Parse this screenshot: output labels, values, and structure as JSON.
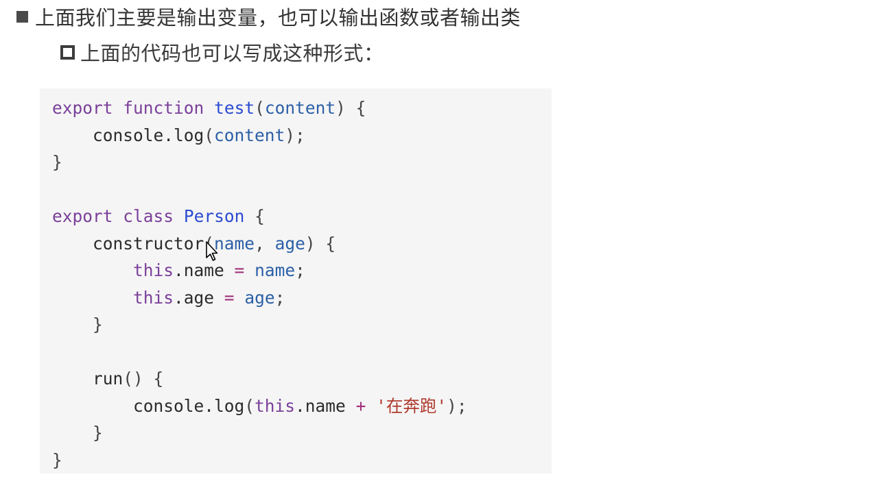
{
  "bullets": [
    {
      "text": "上面我们主要是输出变量，也可以输出函数或者输出类"
    },
    {
      "text": "上面的代码也可以写成这种形式："
    }
  ],
  "code": {
    "lines": [
      [
        {
          "t": "export",
          "c": "kw"
        },
        {
          "t": " ",
          "c": "plain"
        },
        {
          "t": "function",
          "c": "kw"
        },
        {
          "t": " ",
          "c": "plain"
        },
        {
          "t": "test",
          "c": "fn"
        },
        {
          "t": "(",
          "c": "punc"
        },
        {
          "t": "content",
          "c": "param"
        },
        {
          "t": ") {",
          "c": "punc"
        }
      ],
      [
        {
          "t": "    console.log",
          "c": "plain"
        },
        {
          "t": "(",
          "c": "punc"
        },
        {
          "t": "content",
          "c": "param"
        },
        {
          "t": ");",
          "c": "punc"
        }
      ],
      [
        {
          "t": "}",
          "c": "punc"
        }
      ],
      [],
      [
        {
          "t": "export",
          "c": "kw"
        },
        {
          "t": " ",
          "c": "plain"
        },
        {
          "t": "class",
          "c": "kw"
        },
        {
          "t": " ",
          "c": "plain"
        },
        {
          "t": "Person",
          "c": "cls"
        },
        {
          "t": " {",
          "c": "punc"
        }
      ],
      [
        {
          "t": "    constructor",
          "c": "plain"
        },
        {
          "t": "(",
          "c": "punc"
        },
        {
          "t": "name",
          "c": "param"
        },
        {
          "t": ", ",
          "c": "punc"
        },
        {
          "t": "age",
          "c": "param"
        },
        {
          "t": ") {",
          "c": "punc"
        }
      ],
      [
        {
          "t": "        ",
          "c": "plain"
        },
        {
          "t": "this",
          "c": "kw"
        },
        {
          "t": ".name ",
          "c": "plain"
        },
        {
          "t": "=",
          "c": "op"
        },
        {
          "t": " ",
          "c": "plain"
        },
        {
          "t": "name",
          "c": "param"
        },
        {
          "t": ";",
          "c": "punc"
        }
      ],
      [
        {
          "t": "        ",
          "c": "plain"
        },
        {
          "t": "this",
          "c": "kw"
        },
        {
          "t": ".age ",
          "c": "plain"
        },
        {
          "t": "=",
          "c": "op"
        },
        {
          "t": " ",
          "c": "plain"
        },
        {
          "t": "age",
          "c": "param"
        },
        {
          "t": ";",
          "c": "punc"
        }
      ],
      [
        {
          "t": "    }",
          "c": "punc"
        }
      ],
      [],
      [
        {
          "t": "    run",
          "c": "plain"
        },
        {
          "t": "() {",
          "c": "punc"
        }
      ],
      [
        {
          "t": "        console.log",
          "c": "plain"
        },
        {
          "t": "(",
          "c": "punc"
        },
        {
          "t": "this",
          "c": "kw"
        },
        {
          "t": ".name ",
          "c": "plain"
        },
        {
          "t": "+",
          "c": "op"
        },
        {
          "t": " ",
          "c": "plain"
        },
        {
          "t": "'在奔跑'",
          "c": "str"
        },
        {
          "t": ");",
          "c": "punc"
        }
      ],
      [
        {
          "t": "    }",
          "c": "punc"
        }
      ],
      [
        {
          "t": "}",
          "c": "punc"
        }
      ]
    ]
  }
}
